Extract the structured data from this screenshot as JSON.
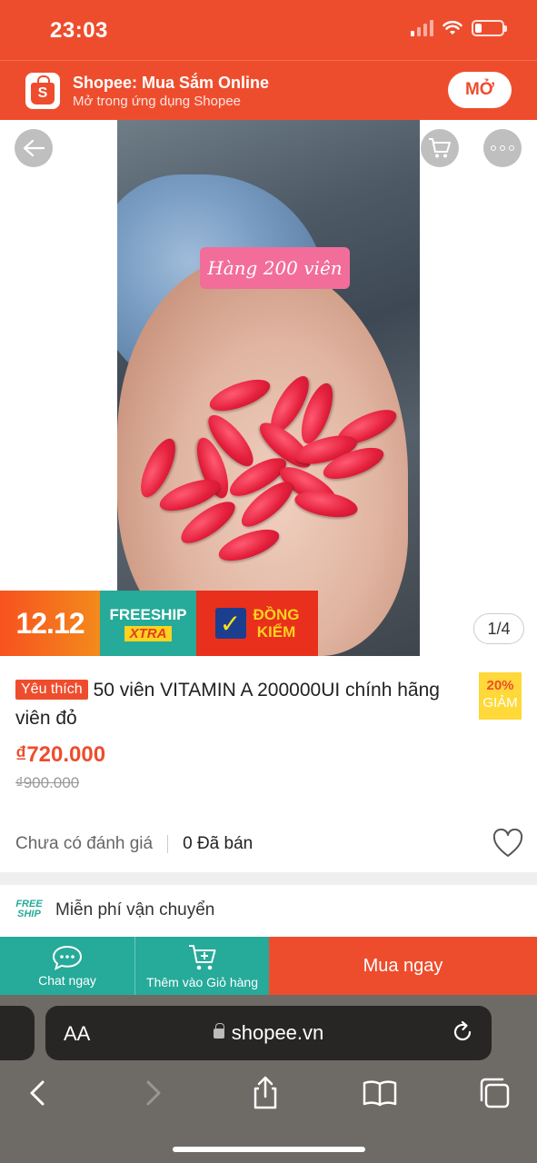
{
  "status_bar": {
    "time": "23:03",
    "battery_level": 0.25
  },
  "app_banner": {
    "logo_letter": "S",
    "title": "Shopee: Mua Sắm Online",
    "subtitle": "Mở trong ứng dụng Shopee",
    "open_label": "MỞ"
  },
  "gallery": {
    "photo_caption": "Hàng 200 viên",
    "counter": "1/4",
    "icons": {
      "back": "back-arrow-icon",
      "cart": "cart-icon",
      "more": "more-icon"
    }
  },
  "promo": {
    "sale_label": "12.12",
    "freeship_label": "FREESHIP",
    "xtra_label": "XTRA",
    "dongkiem_line1": "ĐỒNG",
    "dongkiem_line2": "KIỂM"
  },
  "product": {
    "badge": "Yêu thích",
    "title": "50 viên VITAMIN A 200000UI chính hãng viên đỏ",
    "discount_pct": "20%",
    "discount_label": "GIẢM",
    "price": "₫720.000",
    "old_price": "₫900.000",
    "rating_text": "Chưa có đánh giá",
    "sold_text": "0 Đã bán",
    "shipping_icon_text": "FREE SHIP",
    "shipping_text": "Miễn phí vận chuyển"
  },
  "actions": {
    "chat_label": "Chat ngay",
    "add_cart_label": "Thêm vào Giỏ hàng",
    "buy_label": "Mua ngay"
  },
  "browser": {
    "text_size_label": "AA",
    "url": "shopee.vn"
  },
  "colors": {
    "brand": "#ee4d2d",
    "teal": "#26aa99",
    "yellow": "#ffd839"
  }
}
